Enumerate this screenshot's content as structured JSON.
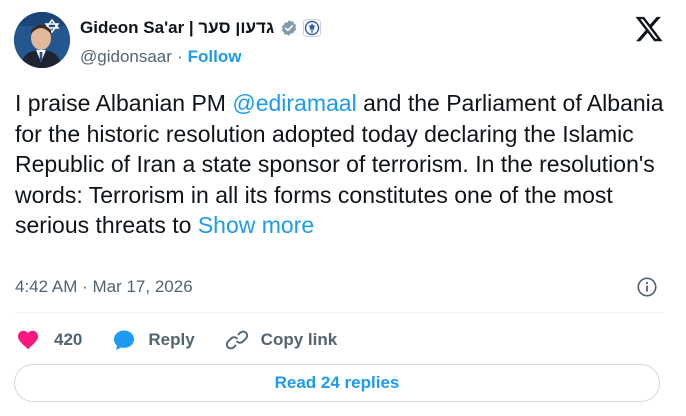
{
  "author": {
    "display_name": "Gideon Sa'ar | גדעון סער",
    "handle": "@gidonsaar",
    "separator": "·",
    "follow_label": "Follow"
  },
  "tweet": {
    "text_before": "I praise Albanian PM ",
    "mention": "@ediramaal",
    "text_after": " and the Parliament of Albania for the historic resolution adopted today declaring the Islamic Republic of Iran a state sponsor of terrorism. In the resolution's words: Terrorism in all its forms constitutes one of the most serious threats to ",
    "show_more": "Show more"
  },
  "meta": {
    "timestamp": "4:42 AM · Mar 17, 2026"
  },
  "actions": {
    "like_count": "420",
    "reply_label": "Reply",
    "copy_link_label": "Copy link"
  },
  "replies": {
    "label": "Read 24 replies"
  },
  "colors": {
    "accent": "#1d9bf0",
    "like": "#f91880",
    "secondary_text": "#536471",
    "border": "#cfd9de"
  }
}
